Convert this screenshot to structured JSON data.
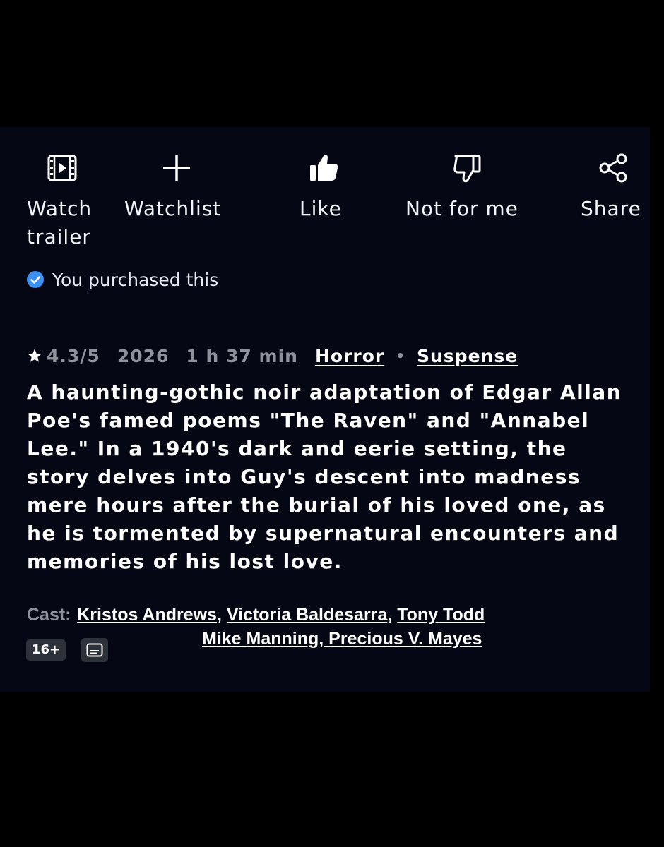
{
  "actions": {
    "trailer": {
      "label_line1": "Watch",
      "label_line2": "trailer",
      "icon": "trailer-icon"
    },
    "watchlist": {
      "label": "Watchlist",
      "icon": "plus-icon"
    },
    "like": {
      "label": "Like",
      "icon": "thumbs-up-icon"
    },
    "dislike": {
      "label": "Not for me",
      "icon": "thumbs-down-icon"
    },
    "share": {
      "label": "Share",
      "icon": "share-icon"
    }
  },
  "purchase": {
    "text": "You purchased this",
    "icon": "check-circle-icon",
    "color": "#3b8ff0"
  },
  "meta": {
    "rating": "4.3/5",
    "year": "2026",
    "duration": "1 h 37 min",
    "genres": [
      "Horror",
      "Suspense"
    ]
  },
  "synopsis": "A haunting-gothic noir adaptation of Edgar Allan Poe's famed poems \"The Raven\" and \"Annabel Lee.\" In a 1940's dark and eerie setting, the story delves into Guy's descent into madness mere hours after the burial of his loved one, as he is tormented by supernatural encounters and memories of his lost love.",
  "cast": {
    "label": "Cast:",
    "names": [
      "Kristos Andrews",
      "Victoria Baldesarra",
      "Tony Todd"
    ],
    "line2": "Mike Manning, Precious V. Mayes"
  },
  "badges": {
    "maturity": "16+",
    "subtitles_icon": "subtitles-icon"
  },
  "colors": {
    "panel": "#050814",
    "muted": "#8d929c",
    "badge": "#2d3139"
  }
}
